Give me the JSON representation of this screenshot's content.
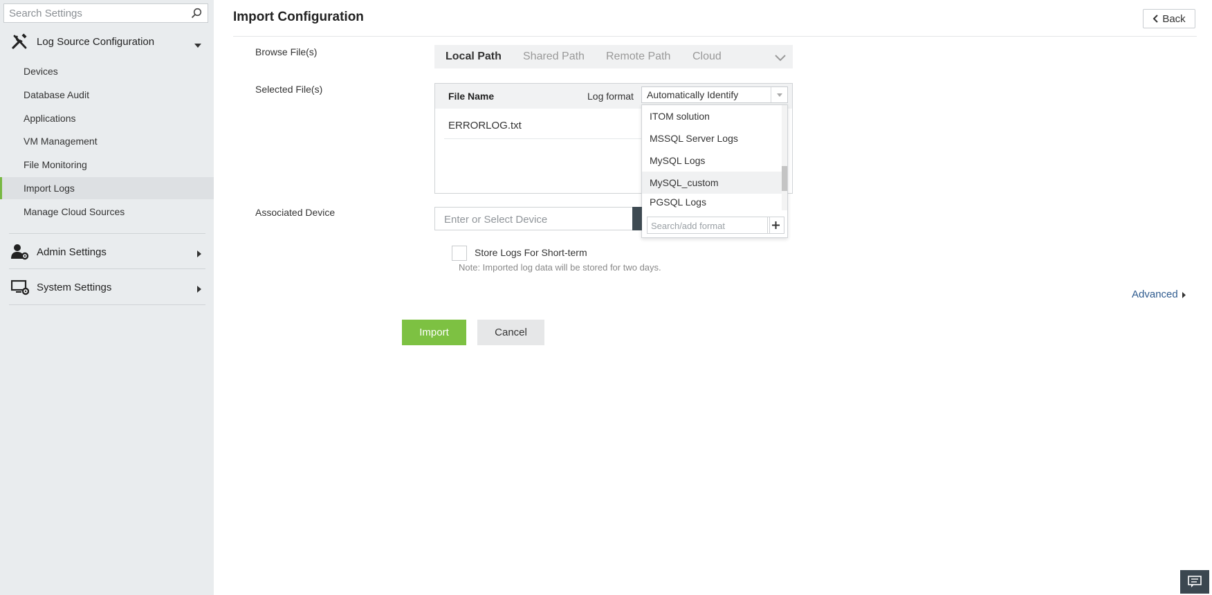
{
  "sidebar": {
    "search_placeholder": "Search Settings",
    "groups": [
      {
        "label": "Log Source Configuration",
        "icon": "tools-icon",
        "expanded": true
      },
      {
        "label": "Admin Settings",
        "icon": "admin-user-gear-icon",
        "expanded": false
      },
      {
        "label": "System Settings",
        "icon": "monitor-gear-icon",
        "expanded": false
      }
    ],
    "items": [
      "Devices",
      "Database Audit",
      "Applications",
      "VM Management",
      "File Monitoring",
      "Import Logs",
      "Manage Cloud Sources"
    ],
    "active_item": "Import Logs",
    "accent_color": "#78b843"
  },
  "header": {
    "title": "Import Configuration",
    "back_label": "Back"
  },
  "form": {
    "browse_label": "Browse File(s)",
    "tabs": [
      "Local Path",
      "Shared Path",
      "Remote Path",
      "Cloud"
    ],
    "active_tab": "Local Path",
    "selected_label": "Selected File(s)",
    "table": {
      "col_file": "File Name",
      "col_format": "Log format",
      "file": "ERRORLOG.txt"
    },
    "log_format": {
      "value": "Automatically Identify",
      "options": [
        "ITOM solution",
        "MSSQL Server Logs",
        "MySQL Logs",
        "MySQL_custom",
        "PGSQL Logs"
      ],
      "hovered": "MySQL_custom",
      "search_placeholder": "Search/add format"
    },
    "device_label": "Associated Device",
    "device_placeholder": "Enter or Select Device",
    "store_label": "Store Logs For Short-term",
    "store_checked": false,
    "note": "Note: Imported log data will be stored for two days.",
    "advanced_label": "Advanced",
    "import_label": "Import",
    "cancel_label": "Cancel",
    "import_color": "#7dc142"
  },
  "chat": {
    "icon": "chat-icon"
  }
}
